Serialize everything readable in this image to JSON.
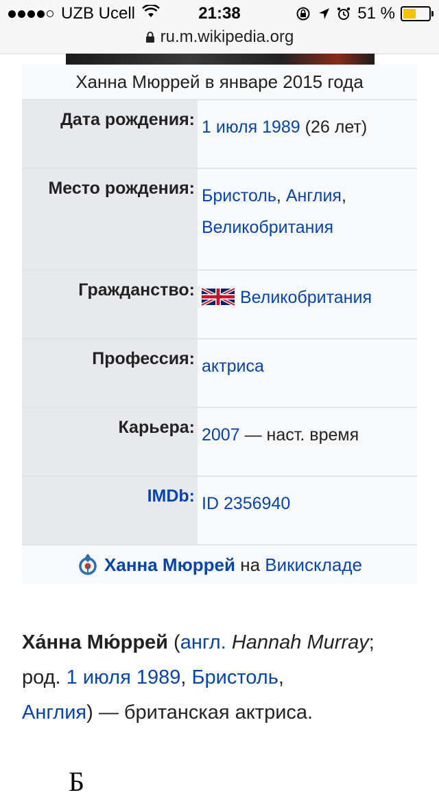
{
  "status_bar": {
    "carrier": "UZB Ucell",
    "time": "21:38",
    "battery_percent_text": "51 %",
    "battery_level": 0.51,
    "signal_filled": 4,
    "signal_total": 5,
    "icons": [
      "wifi-icon",
      "rotation-lock-icon",
      "location-arrow-icon",
      "alarm-icon",
      "battery-icon"
    ]
  },
  "browser": {
    "url": "ru.m.wikipedia.org"
  },
  "infobox": {
    "caption": "Ханна Мюррей в январе 2015 года",
    "rows": [
      {
        "label": "Дата рождения:",
        "link": "1 июля 1989",
        "rest": " (26 лет)"
      },
      {
        "label": "Место рождения:",
        "link1": "Бристоль",
        "sep": ", ",
        "link2": "Англия",
        "sep2": ",",
        "link3": "Великобритания"
      },
      {
        "label": "Гражданство:",
        "link": "Великобритания",
        "flag": "uk-flag-icon"
      },
      {
        "label": "Профессия:",
        "link": "актриса"
      },
      {
        "label": "Карьера:",
        "link": "2007",
        "rest": " — наст. время"
      },
      {
        "label": "IMDb:",
        "link": "ID 2356940"
      }
    ],
    "commons": {
      "name": "Ханна Мюррей",
      "on": " на ",
      "site": "Викискладе"
    }
  },
  "article": {
    "name_bold": "Ха́нна Мю́ррей",
    "open_paren": " (",
    "lang_link": "англ.",
    "lang_name": " Hannah Murray",
    "semicolon": ";",
    "born": "род. ",
    "date_link": "1 июля 1989",
    "comma1": ", ",
    "city_link": "Бристоль",
    "comma2": ",",
    "country_link": "Англия",
    "rest": ") — британская актриса.",
    "next_heading": "Б"
  }
}
